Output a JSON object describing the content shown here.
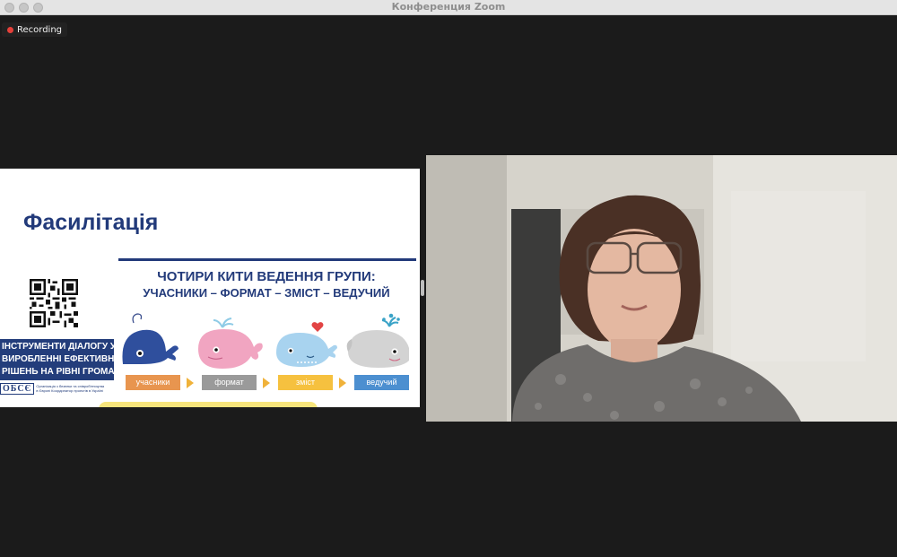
{
  "window": {
    "title": "Конференция Zoom"
  },
  "recording": {
    "label": "Recording"
  },
  "slide": {
    "title": "Фасилітація",
    "heading_line1": "ЧОТИРИ КИТИ ВЕДЕННЯ ГРУПИ:",
    "heading_line2": "УЧАСНИКИ – ФОРМАТ – ЗМІСТ – ВЕДУЧИЙ",
    "project_box": [
      "ІНСТРУМЕНТИ ДІАЛОГУ У",
      "ВИРОБЛЕННІ ЕФЕКТИВНИХ",
      "РІШЕНЬ НА РІВНІ ГРОМАДИ"
    ],
    "osce_logo": "ОБСЄ",
    "osce_caption": "Організація з безпеки та співробітництва в Європі Координатор проектів в Україні",
    "steps": [
      {
        "label": "учасники",
        "color": "#e8954f"
      },
      {
        "label": "формат",
        "color": "#9a9a9a"
      },
      {
        "label": "зміст",
        "color": "#f6c13f"
      },
      {
        "label": "ведучий",
        "color": "#4c8fd0"
      }
    ]
  },
  "video": {
    "participant_icon": "person-video-feed"
  }
}
